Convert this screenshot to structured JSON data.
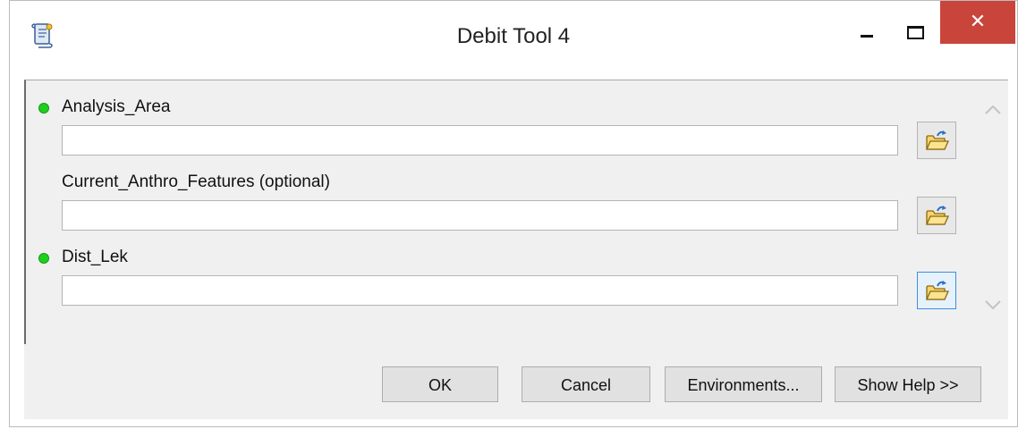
{
  "window": {
    "title": "Debit Tool 4",
    "close_glyph": "✕",
    "icons": {
      "app": "script-tool-icon",
      "minimize": "minimize-icon",
      "maximize": "maximize-icon",
      "close": "close-icon"
    },
    "close_color": "#c9443b"
  },
  "parameters": [
    {
      "label": "Analysis_Area",
      "required": true,
      "value": ""
    },
    {
      "label": "Current_Anthro_Features (optional)",
      "required": false,
      "value": ""
    },
    {
      "label": "Dist_Lek",
      "required": true,
      "value": ""
    }
  ],
  "colors": {
    "required_dot": "#1fcf1f",
    "panel_bg": "#f0f0f0",
    "focus_border": "#3d8fe0"
  },
  "buttons": {
    "ok": "OK",
    "cancel": "Cancel",
    "environments": "Environments...",
    "show_help": "Show Help >>"
  },
  "browse_icon": "open-folder-icon"
}
